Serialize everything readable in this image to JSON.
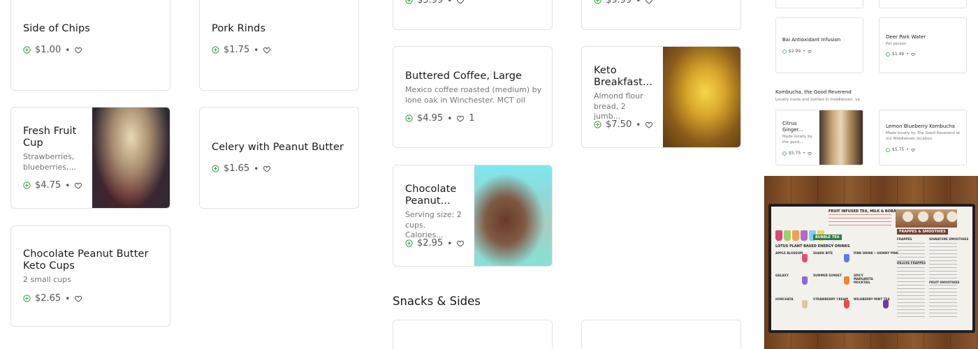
{
  "section_snacks": "Snacks & Sides",
  "colors": {
    "accent": "#3aa14a",
    "border": "#e2e2e2",
    "text": "#191919",
    "muted": "#767676"
  },
  "cards": {
    "top_a": {
      "price": "$5.99"
    },
    "top_b": {
      "price": "$9.99"
    },
    "side_chips": {
      "name": "Side of Chips",
      "price": "$1.00"
    },
    "pork_rinds": {
      "name": "Pork Rinds",
      "price": "$1.75"
    },
    "buttered_coffee": {
      "name": "Buttered Coffee, Large",
      "desc": "Mexico coffee roasted (medium) by lone oak in Winchester. MCT oil and...",
      "price": "$4.95",
      "likes": "1"
    },
    "keto_breakfast": {
      "name": "Keto Breakfast...",
      "desc": "Almond flour bread, 2 jumb...",
      "price": "$7.50"
    },
    "fresh_fruit": {
      "name": "Fresh Fruit Cup",
      "desc": "Strawberries, blueberries,...",
      "price": "$4.75"
    },
    "celery": {
      "name": "Celery with Peanut Butter",
      "price": "$1.65"
    },
    "choc_peanut": {
      "name": "Chocolate Peanut...",
      "desc": "Serving size: 2 cups. Calories...",
      "price": "$2.95"
    },
    "choc_keto_cups": {
      "name": "Chocolate Peanut Butter Keto Cups",
      "desc": "2 small cups",
      "price": "$2.65"
    }
  },
  "side_panel": {
    "bai": {
      "name": "Bai Antioxidant Infusion",
      "price": "$2.99"
    },
    "deer_park": {
      "name": "Deer Park Water",
      "desc": "Per person",
      "price": "$1.49"
    },
    "kombucha_section": "Kombucha, the Good Reverend",
    "kombucha_sub": "Locally made and bottled in middletown, va",
    "citrus": {
      "name": "Citrus Ginger...",
      "desc": "Made locally by the good...",
      "price": "$5.75"
    },
    "lemon": {
      "name": "Lemon Blueberry Kombucha",
      "desc": "Made locally by The Good Reverend at our Middletown location.",
      "price": "$5.75"
    }
  },
  "menu_board": {
    "bubble_tea": "BUBBLE TEA",
    "frappes": "FRAPPES & SMOOTHIES",
    "fruit_infused": "FRUIT INFUSED TEA, MILK & BOBA",
    "lotus": "LOTUS PLANT BASED ENERGY DRINKS",
    "items": [
      "APPLE BLOSSOM",
      "SHARK BITE",
      "PINK DRINK • SKINNY PINK",
      "GALAXY",
      "SUMMER SUNSET",
      "SPICY MARGARITA MOCKTAIL",
      "HORCHATA",
      "STRAWBERRY CREAM",
      "WILDBERRY MINT TEA"
    ],
    "right_items": [
      "FRAPPÉS",
      "SIGNATURE SMOOTHIES",
      "DELUXE FRAPPES",
      "FRUIT SMOOTHIES"
    ]
  }
}
